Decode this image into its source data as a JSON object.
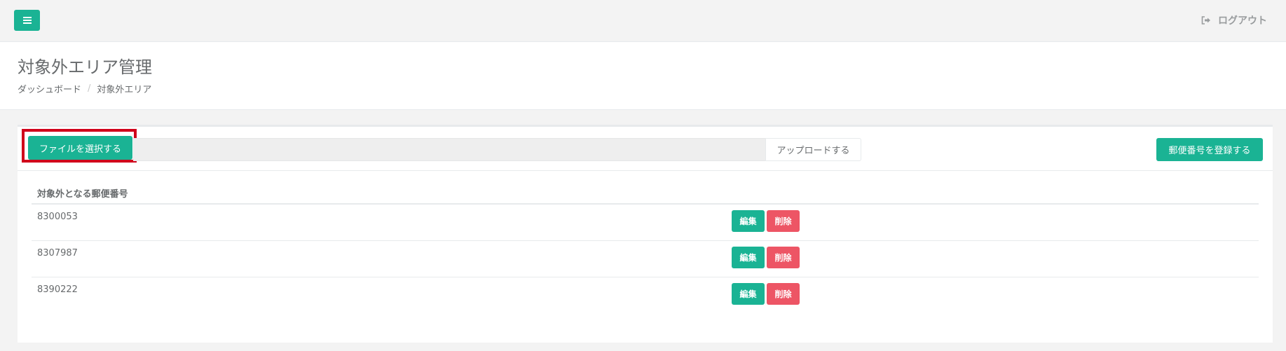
{
  "topbar": {
    "menu_icon": "hamburger-menu-icon",
    "logout_icon": "sign-out-icon",
    "logout_label": "ログアウト"
  },
  "heading": {
    "title": "対象外エリア管理",
    "breadcrumb": {
      "home": "ダッシュボード",
      "separator": "/",
      "current": "対象外エリア"
    }
  },
  "toolbar": {
    "choose_file_label": "ファイルを選択する",
    "file_name_value": "",
    "upload_label": "アップロードする",
    "register_label": "郵便番号を登録する"
  },
  "table": {
    "column_header": "対象外となる郵便番号",
    "rows": [
      {
        "code": "8300053",
        "edit_label": "編集",
        "delete_label": "削除"
      },
      {
        "code": "8307987",
        "edit_label": "編集",
        "delete_label": "削除"
      },
      {
        "code": "8390222",
        "edit_label": "編集",
        "delete_label": "削除"
      }
    ]
  },
  "colors": {
    "primary": "#1ab394",
    "danger": "#ed5565",
    "highlight": "#d0021b",
    "text": "#676a6c",
    "background": "#f3f3f3"
  }
}
